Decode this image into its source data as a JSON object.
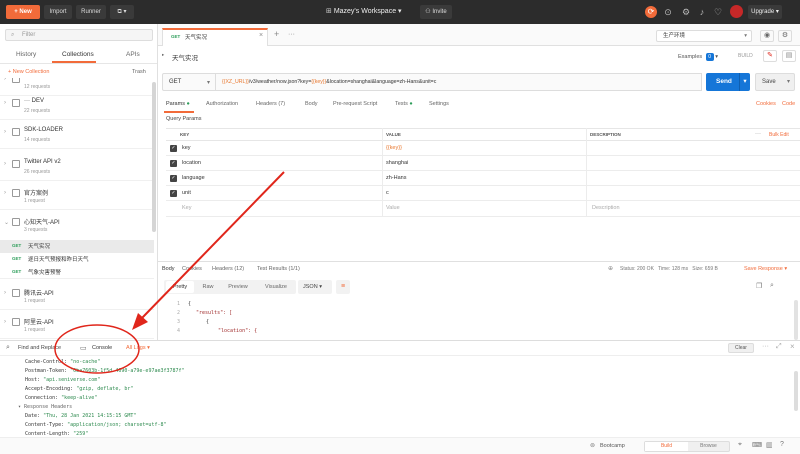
{
  "topbar": {
    "new_label": "+ New",
    "import_label": "Import",
    "runner_label": "Runner",
    "workspace": "Mazey's Workspace",
    "invite_label": "Invite",
    "upgrade_label": "Upgrade"
  },
  "sidebar": {
    "search_placeholder": "Filter",
    "tabs": [
      "History",
      "Collections",
      "APIs"
    ],
    "new_collection": "+ New Collection",
    "trash": "Trash",
    "collections": [
      {
        "name": "",
        "requests": "12 requests"
      },
      {
        "name": "··· DEV",
        "requests": "22 requests"
      },
      {
        "name": "SDK-LOADER",
        "requests": "14 requests"
      },
      {
        "name": "Twitter API v2",
        "requests": "26 requests"
      },
      {
        "name": "官方案例",
        "requests": "1 request"
      },
      {
        "name": "心知天气-API",
        "requests": "3 requests"
      }
    ],
    "subrequests": [
      {
        "method": "GET",
        "name": "天气实况"
      },
      {
        "method": "GET",
        "name": "逐日天气预报和昨日天气"
      },
      {
        "method": "GET",
        "name": "气象灾害预警"
      }
    ],
    "collections_after": [
      {
        "name": "腾讯云-API",
        "requests": "1 request"
      },
      {
        "name": "阿里云-API",
        "requests": "1 request"
      }
    ]
  },
  "tabs": {
    "active_method": "GET",
    "active_name": "天气实况"
  },
  "env": {
    "selected": "生产环境"
  },
  "request": {
    "title": "天气实况",
    "examples": "Examples",
    "examples_count": "0",
    "build": "BUILD",
    "method": "GET",
    "url_prefix": "{{XZ_URL}}",
    "url_path": "/v3/weather/now.json?key=",
    "url_key": "{{key}}",
    "url_rest": "&location=shanghai&language=zh-Hans&unit=c",
    "send": "Send",
    "save": "Save"
  },
  "param_tabs": [
    {
      "label": "Params",
      "dot": true
    },
    {
      "label": "Authorization"
    },
    {
      "label": "Headers (7)"
    },
    {
      "label": "Body"
    },
    {
      "label": "Pre-request Script"
    },
    {
      "label": "Tests",
      "dot": true
    },
    {
      "label": "Settings"
    }
  ],
  "cookies": "Cookies",
  "code": "Code",
  "params": {
    "section": "Query Params",
    "col_key": "KEY",
    "col_value": "VALUE",
    "col_desc": "DESCRIPTION",
    "bulk_edit": "Bulk Edit",
    "rows": [
      {
        "key": "key",
        "value": "{{key}}"
      },
      {
        "key": "location",
        "value": "shanghai"
      },
      {
        "key": "language",
        "value": "zh-Hans"
      },
      {
        "key": "unit",
        "value": "c"
      }
    ],
    "placeholder_key": "Key",
    "placeholder_value": "Value",
    "placeholder_desc": "Description"
  },
  "response": {
    "tabs": [
      "Body",
      "Cookies",
      "Headers (12)",
      "Test Results (1/1)"
    ],
    "status": "Status: 200 OK",
    "time": "Time: 128 ms",
    "size": "Size: 659 B",
    "save_response": "Save Response",
    "views": [
      "Pretty",
      "Raw",
      "Preview",
      "Visualize"
    ],
    "format": "JSON",
    "lines": [
      {
        "n": "1",
        "text": "{"
      },
      {
        "n": "2",
        "text": "\"results\": ["
      },
      {
        "n": "3",
        "text": "{"
      },
      {
        "n": "4",
        "text": "\"location\": {"
      }
    ]
  },
  "console": {
    "find_replace": "Find and Replace",
    "tab": "Console",
    "filter": "All Logs",
    "clear": "Clear",
    "lines": [
      {
        "k": "Cache-Control:",
        "v": "\"no-cache\""
      },
      {
        "k": "Postman-Token:",
        "v": "\"0ba7603b-1f5d-4690-a79e-e97ae3f3787f\""
      },
      {
        "k": "Host:",
        "v": "\"api.seniverse.com\""
      },
      {
        "k": "Accept-Encoding:",
        "v": "\"gzip, deflate, br\""
      },
      {
        "k": "Connection:",
        "v": "\"keep-alive\""
      },
      {
        "k": "▾ Response Headers",
        "v": ""
      },
      {
        "k": "Date:",
        "v": "\"Thu, 28 Jan 2021 14:15:15 GMT\""
      },
      {
        "k": "Content-Type:",
        "v": "\"application/json; charset=utf-8\""
      },
      {
        "k": "Content-Length:",
        "v": "\"259\""
      }
    ]
  },
  "statusbar": {
    "bootcamp": "Bootcamp",
    "build": "Build",
    "browse": "Browse"
  },
  "colors": {
    "accent": "#f26b3a",
    "send": "#1576d8",
    "annotation": "#e0261b"
  }
}
